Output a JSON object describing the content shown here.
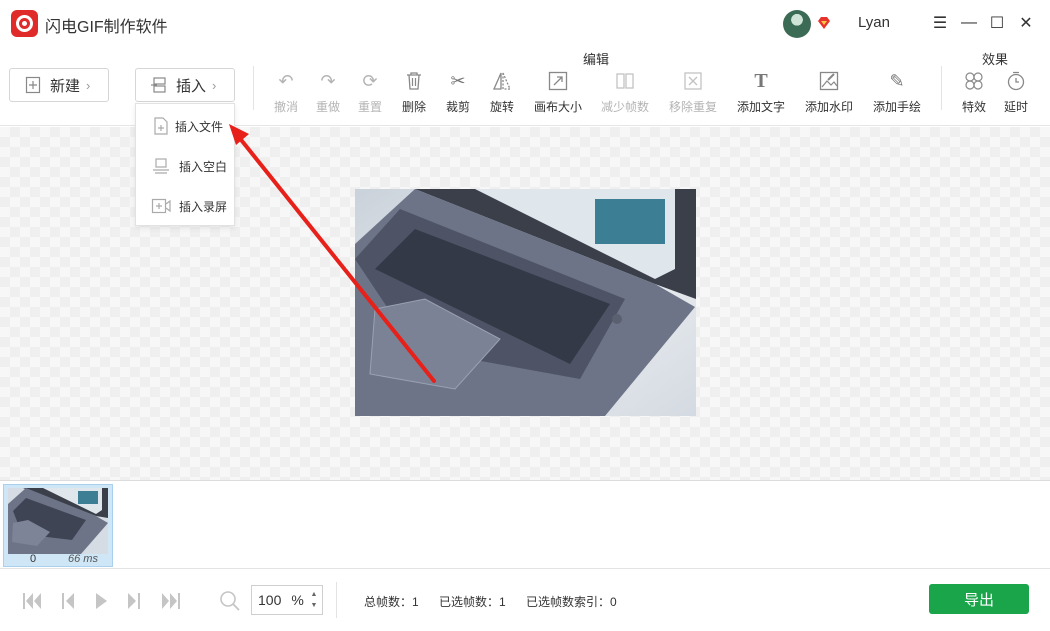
{
  "app": {
    "title": "闪电GIF制作软件",
    "username": "Lyan",
    "logo": "app-logo"
  },
  "window_controls": {
    "menu": "☰",
    "minimize": "—",
    "maximize": "☐",
    "close": "✕"
  },
  "toolbar": {
    "new_label": "新建",
    "insert_label": "插入",
    "edit_group_label": "编辑",
    "effect_group_label": "效果",
    "tools": [
      {
        "label": "撤消",
        "icon": "undo-icon",
        "enabled": false
      },
      {
        "label": "重做",
        "icon": "redo-icon",
        "enabled": false
      },
      {
        "label": "重置",
        "icon": "reset-icon",
        "enabled": false
      },
      {
        "label": "删除",
        "icon": "delete-icon",
        "enabled": true
      },
      {
        "label": "裁剪",
        "icon": "crop-icon",
        "enabled": true
      },
      {
        "label": "旋转",
        "icon": "rotate-icon",
        "enabled": true
      },
      {
        "label": "画布大小",
        "icon": "canvas-size-icon",
        "enabled": true
      },
      {
        "label": "减少帧数",
        "icon": "reduce-frames-icon",
        "enabled": false
      },
      {
        "label": "移除重复",
        "icon": "remove-duplicate-icon",
        "enabled": false
      },
      {
        "label": "添加文字",
        "icon": "text-icon",
        "enabled": true
      },
      {
        "label": "添加水印",
        "icon": "watermark-icon",
        "enabled": true
      },
      {
        "label": "添加手绘",
        "icon": "draw-icon",
        "enabled": true
      },
      {
        "label": "特效",
        "icon": "effects-icon",
        "enabled": true
      },
      {
        "label": "延时",
        "icon": "delay-icon",
        "enabled": true
      }
    ]
  },
  "insert_menu": {
    "items": [
      {
        "label": "插入文件",
        "icon": "insert-file-icon"
      },
      {
        "label": "插入空白",
        "icon": "insert-blank-icon"
      },
      {
        "label": "插入录屏",
        "icon": "insert-record-icon"
      }
    ]
  },
  "timeline": {
    "frames": [
      {
        "index": "0",
        "duration": "66 ms"
      }
    ]
  },
  "bottom": {
    "zoom_value": "100",
    "zoom_unit": "%",
    "total_frames": "总帧数：1",
    "selected_frames": "已选帧数：1",
    "selected_index": "已选帧数索引：0",
    "export_label": "导出"
  },
  "colors": {
    "accent_red": "#e02b2b",
    "export_green": "#1aa54b",
    "arrow_red": "#e8201a",
    "selection_blue": "#cfe6f6"
  }
}
